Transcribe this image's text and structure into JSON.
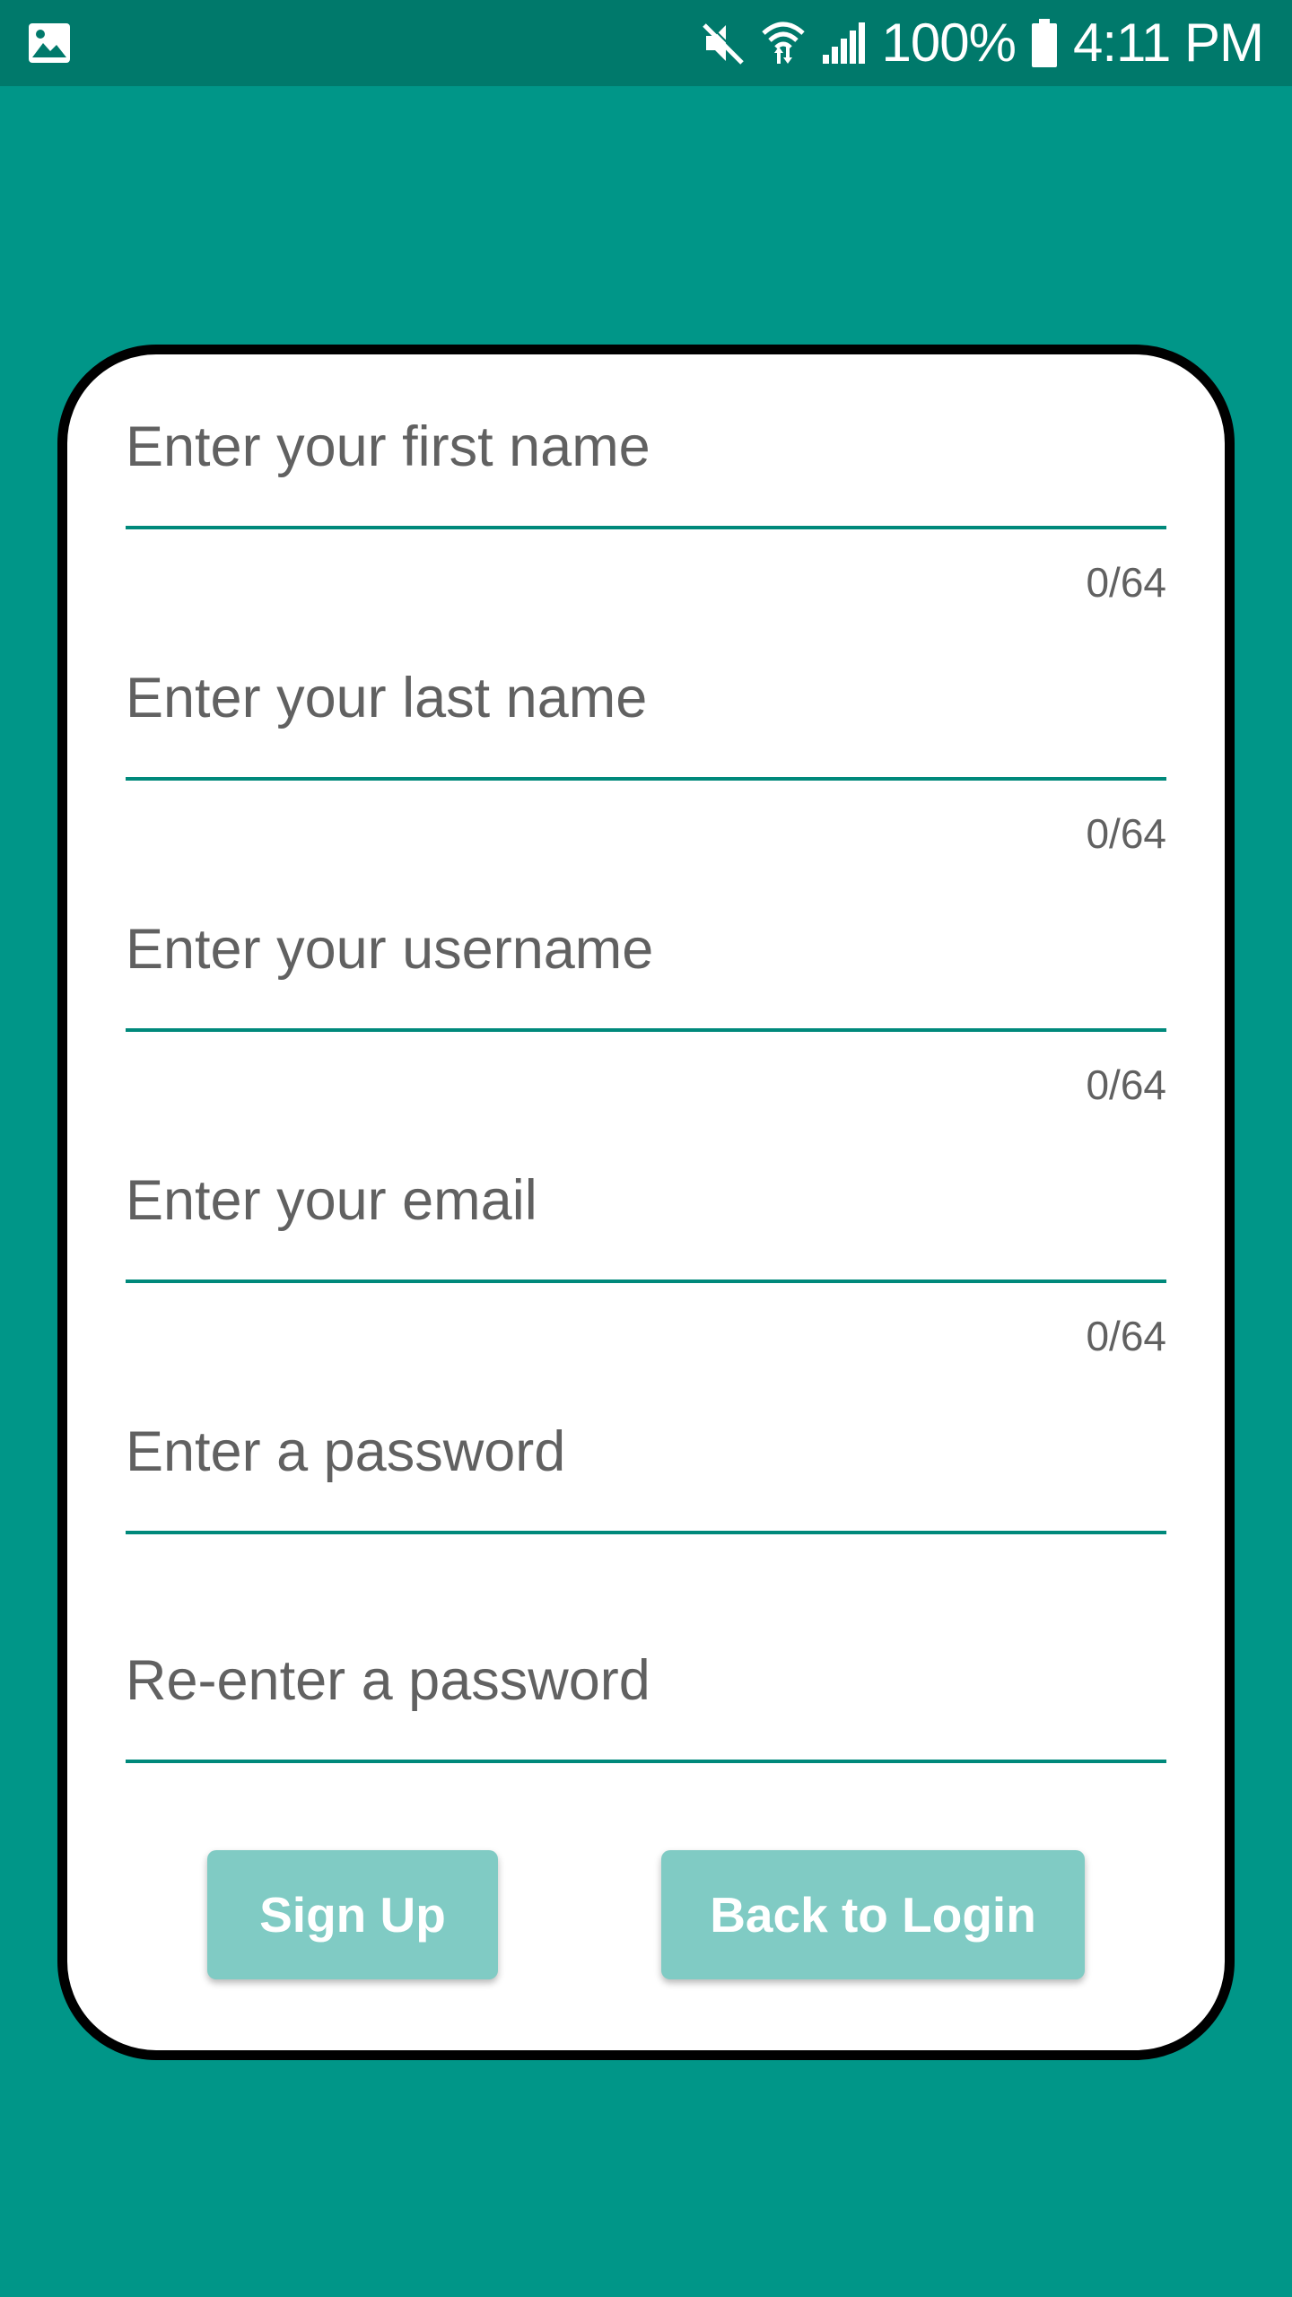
{
  "status_bar": {
    "battery_percent": "100%",
    "time": "4:11 PM",
    "icons": [
      "image-icon",
      "mute-icon",
      "wifi-icon",
      "signal-icon",
      "battery-icon"
    ]
  },
  "form": {
    "first_name": {
      "value": "",
      "placeholder": "Enter your first name",
      "counter": "0/64"
    },
    "last_name": {
      "value": "",
      "placeholder": "Enter your last name",
      "counter": "0/64"
    },
    "username": {
      "value": "",
      "placeholder": "Enter your username",
      "counter": "0/64"
    },
    "email": {
      "value": "",
      "placeholder": "Enter your email",
      "counter": "0/64"
    },
    "password": {
      "value": "",
      "placeholder": "Enter a password"
    },
    "confirm_password": {
      "value": "",
      "placeholder": "Re-enter a password"
    }
  },
  "buttons": {
    "sign_up": "Sign Up",
    "back_to_login": "Back to Login"
  },
  "colors": {
    "background": "#009688",
    "status_bar": "#00796B",
    "card": "#FFFFFF",
    "card_border": "#000000",
    "underline": "#00897B",
    "button": "#80CBC4",
    "text": "#616161"
  }
}
